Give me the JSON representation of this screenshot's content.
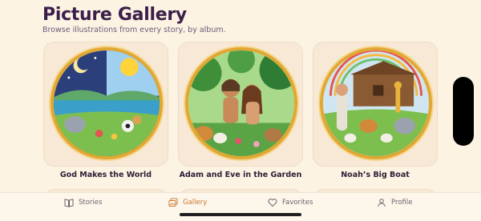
{
  "header": {
    "title": "Picture Gallery",
    "subtitle": "Browse illustrations from every story, by album."
  },
  "gallery": {
    "items": [
      {
        "caption": "God Makes the World",
        "icon": "creation-illustration"
      },
      {
        "caption": "Adam and Eve in the Garden",
        "icon": "garden-illustration"
      },
      {
        "caption": "Noah’s Big Boat",
        "icon": "ark-illustration"
      }
    ]
  },
  "bottom_nav": {
    "items": [
      {
        "label": "Stories",
        "icon": "book-icon",
        "active": false
      },
      {
        "label": "Gallery",
        "icon": "gallery-icon",
        "active": true
      },
      {
        "label": "Favorites",
        "icon": "heart-icon",
        "active": false
      },
      {
        "label": "Profile",
        "icon": "person-icon",
        "active": false
      }
    ]
  },
  "colors": {
    "background": "#fcf3e3",
    "card": "#f8e9d6",
    "frame_gold": "#e0a832",
    "accent_active": "#c97a33",
    "title": "#3b1f4a"
  }
}
